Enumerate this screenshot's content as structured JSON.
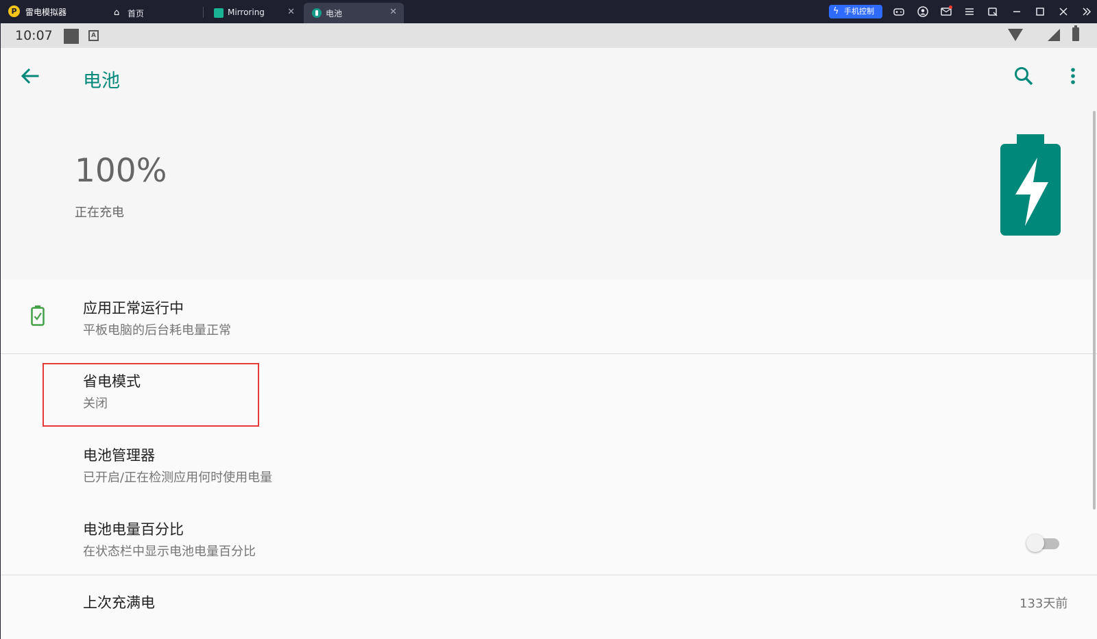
{
  "emulator": {
    "app_name": "雷电模拟器",
    "tabs": [
      {
        "label": "首页",
        "icon": "home-icon"
      },
      {
        "label": "Mirroring",
        "icon": "mirroring-app-icon"
      },
      {
        "label": "电池",
        "icon": "battery-app-icon",
        "active": true
      }
    ],
    "phone_control_label": "手机控制",
    "controls": [
      "gamepad-icon",
      "account-icon",
      "mail-icon",
      "menu-icon",
      "window-icon",
      "minimize-icon",
      "maximize-icon",
      "close-icon",
      "expand-icon"
    ]
  },
  "statusbar": {
    "time": "10:07",
    "notif_badge": "A"
  },
  "appbar": {
    "title": "电池",
    "accent_color": "#00897b"
  },
  "battery": {
    "percent_text": "100%",
    "status": "正在充电",
    "icon_color": "#00897b"
  },
  "settings": [
    {
      "title": "应用正常运行中",
      "summary": "平板电脑的后台耗电量正常",
      "icon": "battery-ok-icon"
    },
    {
      "title": "省电模式",
      "summary": "关闭",
      "highlighted": true
    },
    {
      "title": "电池管理器",
      "summary": "已开启/正在检测应用何时使用电量"
    },
    {
      "title": "电池电量百分比",
      "summary": "在状态栏中显示电池电量百分比",
      "toggle": false
    },
    {
      "title": "上次充满电",
      "value": "133天前"
    }
  ]
}
